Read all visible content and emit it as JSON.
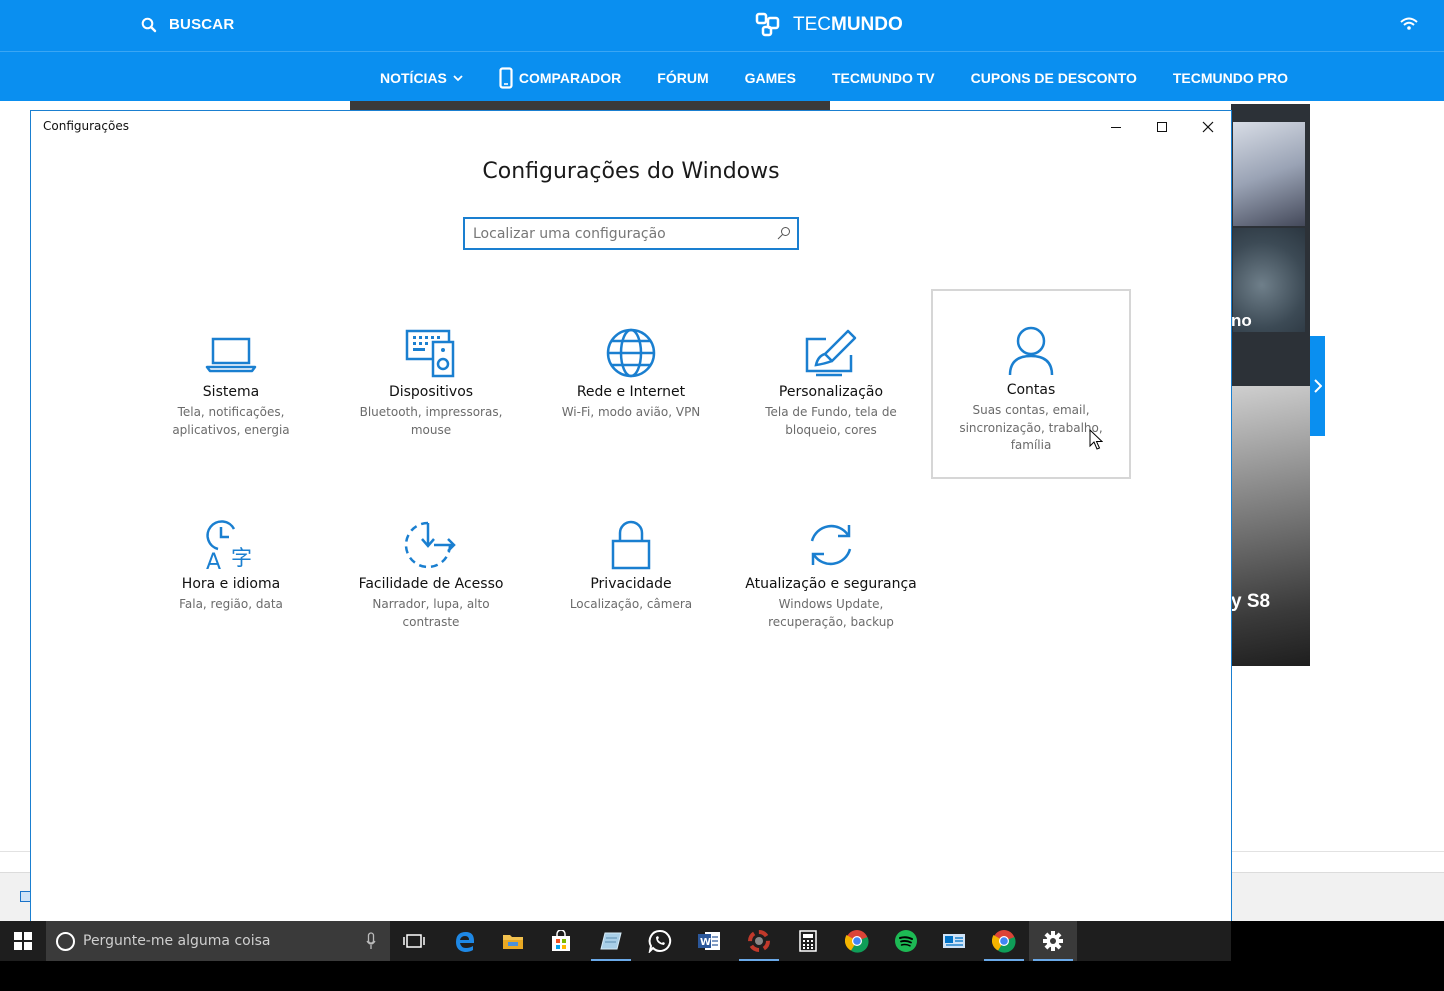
{
  "website": {
    "search_label": "BUSCAR",
    "logo_light": "TEC",
    "logo_bold": "MUNDO",
    "nav": [
      {
        "label": "NOTÍCIAS"
      },
      {
        "label": "COMPARADOR"
      },
      {
        "label": "FÓRUM"
      },
      {
        "label": "GAMES"
      },
      {
        "label": "TECMUNDO TV"
      },
      {
        "label": "CUPONS DE DESCONTO"
      },
      {
        "label": "TECMUNDO PRO"
      }
    ],
    "side_text_1": "no",
    "side_text_2": "y S8",
    "colors": {
      "brand": "#0a8ff0"
    }
  },
  "window": {
    "title": "Configurações",
    "heading": "Configurações do Windows",
    "search_placeholder": "Localizar uma configuração",
    "accent": "#1a7fd0",
    "categories": [
      {
        "icon": "laptop-icon",
        "name": "Sistema",
        "desc": "Tela, notificações, aplicativos, energia"
      },
      {
        "icon": "devices-icon",
        "name": "Dispositivos",
        "desc": "Bluetooth, impressoras, mouse"
      },
      {
        "icon": "globe-icon",
        "name": "Rede e Internet",
        "desc": "Wi-Fi, modo avião, VPN"
      },
      {
        "icon": "personalization-icon",
        "name": "Personalização",
        "desc": "Tela de Fundo, tela de bloqueio, cores"
      },
      {
        "icon": "person-icon",
        "name": "Contas",
        "desc": "Suas contas, email, sincronização, trabalho, família",
        "selected": true
      },
      {
        "icon": "time-language-icon",
        "name": "Hora e idioma",
        "desc": "Fala, região, data"
      },
      {
        "icon": "ease-of-access-icon",
        "name": "Facilidade de Acesso",
        "desc": "Narrador, lupa, alto contraste"
      },
      {
        "icon": "lock-icon",
        "name": "Privacidade",
        "desc": "Localização, câmera"
      },
      {
        "icon": "sync-icon",
        "name": "Atualização e segurança",
        "desc": "Windows Update, recuperação, backup"
      }
    ]
  },
  "taskbar": {
    "search_placeholder": "Pergunte-me alguma coisa",
    "apps": [
      "task-view-icon",
      "edge-icon",
      "file-explorer-icon",
      "store-icon",
      "notepad-icon",
      "whatsapp-icon",
      "word-icon",
      "gimp-icon",
      "calculator-icon",
      "chrome-icon",
      "spotify-icon",
      "outlook-icon",
      "chrome-icon",
      "settings-icon"
    ]
  }
}
